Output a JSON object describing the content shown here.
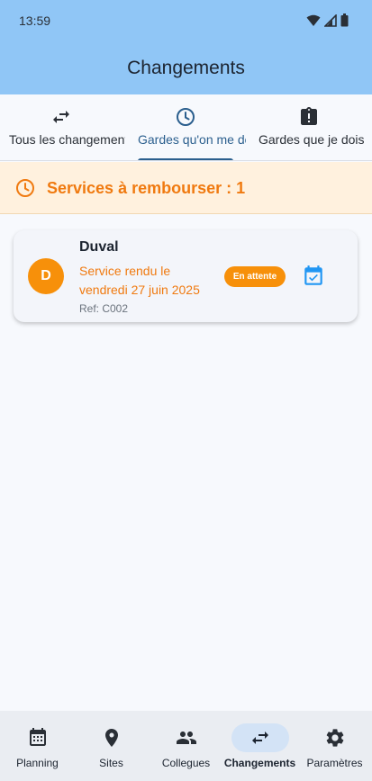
{
  "status_bar": {
    "time": "13:59"
  },
  "app": {
    "title": "Changements"
  },
  "tabs": [
    {
      "label": "Tous les changements",
      "icon": "swap-icon",
      "active": false
    },
    {
      "label": "Gardes qu'on me doit",
      "icon": "clock-icon",
      "active": true
    },
    {
      "label": "Gardes que je dois",
      "icon": "clipboard-alert-icon",
      "active": false
    }
  ],
  "banner": {
    "text": "Services à rembourser : 1",
    "icon": "clock-icon",
    "color": "#f07a10"
  },
  "cards": [
    {
      "avatar_letter": "D",
      "name": "Duval",
      "line1": "Service rendu le",
      "line2": "vendredi 27 juin 2025",
      "ref": "Ref: C002",
      "status": "En attente",
      "status_color": "#f7900a",
      "action_icon": "calendar-check-icon"
    }
  ],
  "bottom_nav": [
    {
      "label": "Planning",
      "icon": "calendar-icon",
      "active": false
    },
    {
      "label": "Sites",
      "icon": "location-pin-icon",
      "active": false
    },
    {
      "label": "Collegues",
      "icon": "people-icon",
      "active": false
    },
    {
      "label": "Changements",
      "icon": "swap-icon",
      "active": true
    },
    {
      "label": "Paramètres",
      "icon": "gear-icon",
      "active": false
    }
  ],
  "colors": {
    "appbar": "#90c6f6",
    "accent": "#2b5f8e",
    "warning": "#f07a10"
  }
}
